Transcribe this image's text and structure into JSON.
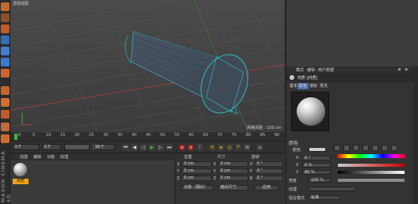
{
  "viewport": {
    "title": "透视视图",
    "readout": "网格间距 : 100 cm"
  },
  "timeline": {
    "ticks": [
      "0",
      "5",
      "10",
      "15",
      "20",
      "25",
      "30",
      "35",
      "40",
      "45",
      "50",
      "55",
      "60",
      "65",
      "70",
      "75",
      "80",
      "85",
      "90"
    ]
  },
  "transport": {
    "current_frame": "0 F",
    "start_frame": "0 F",
    "end_frame": "90 F",
    "max_frame": "90 F"
  },
  "material_manager": {
    "menu": [
      "创建",
      "编辑",
      "功能",
      "纹理"
    ],
    "material_name": "材质"
  },
  "coordinate_manager": {
    "headers": {
      "position": "位置",
      "size": "尺寸",
      "rotation": "旋转"
    },
    "rows": [
      {
        "axis": "X",
        "pos": "0 cm",
        "size": "0 cm",
        "rot_axis": "H",
        "rot": "0 °"
      },
      {
        "axis": "Y",
        "pos": "0 cm",
        "size": "0 cm",
        "rot_axis": "P",
        "rot": "0 °"
      },
      {
        "axis": "Z",
        "pos": "0 cm",
        "size": "0 cm",
        "rot_axis": "B",
        "rot": "0 °"
      }
    ],
    "mode": "对象（相对）",
    "size_mode": "绝对尺寸",
    "apply": "应用"
  },
  "attribute_manager": {
    "menu": [
      "模式",
      "编辑",
      "用户数据"
    ],
    "material_title": "材质 [材质]",
    "subtabs": [
      "基本",
      "颜色",
      "漫射",
      "发光"
    ],
    "section": "颜色",
    "rows": [
      {
        "label": "颜色",
        "value": ""
      },
      {
        "label": "H",
        "value": "0 °"
      },
      {
        "label": "S",
        "value": "0 %"
      },
      {
        "label": "V",
        "value": "80 %"
      },
      {
        "label": "亮度",
        "value": "100 %"
      },
      {
        "label": "纹理",
        "value": ""
      },
      {
        "label": "混合模式",
        "value": "标准"
      }
    ]
  },
  "colors": {
    "object_edges": "#2ad0c8",
    "material_tag": "#f2a21b",
    "frame_marker": "#3fb63f"
  }
}
